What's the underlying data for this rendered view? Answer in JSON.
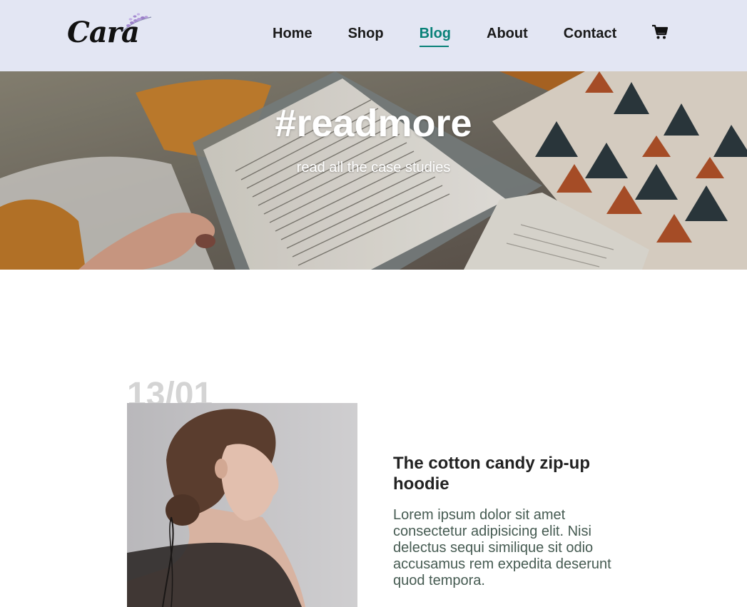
{
  "brand": {
    "name": "Cara"
  },
  "nav": {
    "items": [
      {
        "label": "Home"
      },
      {
        "label": "Shop"
      },
      {
        "label": "Blog"
      },
      {
        "label": "About"
      },
      {
        "label": "Contact"
      }
    ],
    "active_label": "Blog",
    "cart_icon": "cart-icon"
  },
  "hero": {
    "title": "#readmore",
    "subtitle": "read all the case studies"
  },
  "blog": {
    "posts": [
      {
        "date": "13/01",
        "title": "The cotton candy zip-up hoodie",
        "body": "Lorem ipsum dolor sit amet consectetur adipisicing elit. Nisi delectus sequi similique sit odio accusamus rem expedita deserunt quod tempora."
      }
    ]
  },
  "colors": {
    "header_bg": "#e3e6f3",
    "accent": "#088178",
    "date_gray": "#d4d4d4",
    "body_text": "#465b52"
  }
}
